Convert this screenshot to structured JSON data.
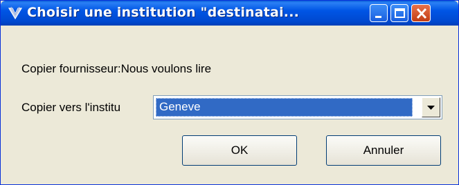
{
  "window": {
    "title": "Choisir une institution \"destinatai...",
    "icon": "vivaldi-app-icon"
  },
  "title_buttons": {
    "minimize": "minimize-icon",
    "maximize": "maximize-icon",
    "close": "close-icon"
  },
  "form": {
    "source_label": "Copier fournisseur:Nous voulons lire",
    "target_label": "Copier vers l'institu",
    "target_value": "Geneve"
  },
  "buttons": {
    "ok_label": "OK",
    "cancel_label": "Annuler"
  },
  "colors": {
    "title_bar": "#0055e5",
    "selection": "#316ac5",
    "dialog_bg": "#ece9d8"
  }
}
